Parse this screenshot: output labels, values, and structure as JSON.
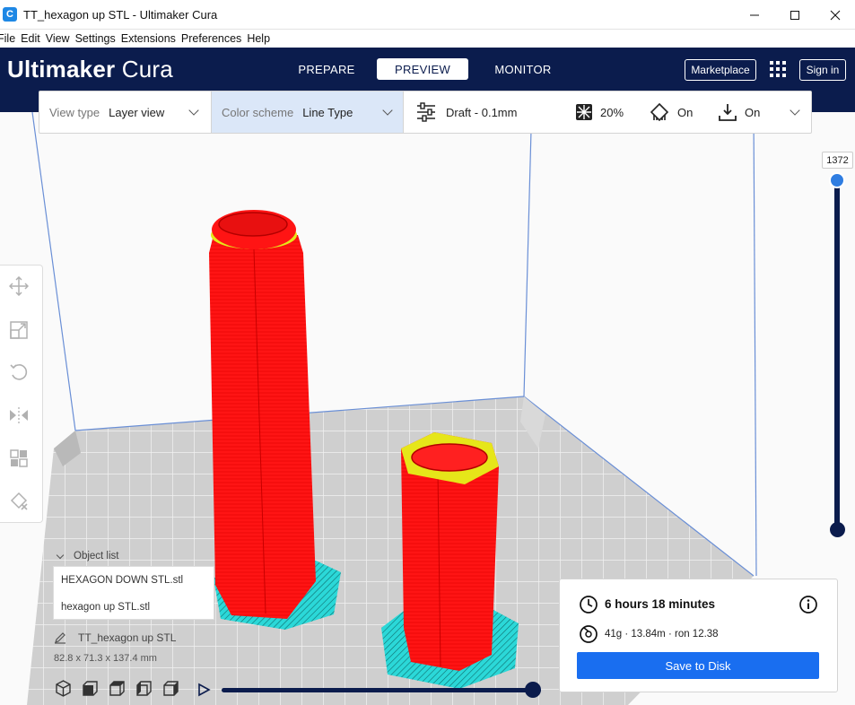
{
  "window": {
    "title": "TT_hexagon up STL - Ultimaker Cura",
    "app_icon_letter": "C"
  },
  "menubar": {
    "items": [
      "File",
      "Edit",
      "View",
      "Settings",
      "Extensions",
      "Preferences",
      "Help"
    ]
  },
  "header": {
    "logo_bold": "Ultimaker",
    "logo_light": "Cura",
    "tabs": [
      {
        "label": "PREPARE",
        "active": false
      },
      {
        "label": "PREVIEW",
        "active": true
      },
      {
        "label": "MONITOR",
        "active": false
      }
    ],
    "marketplace_label": "Marketplace",
    "signin_label": "Sign in"
  },
  "toolbar": {
    "view_type_label": "View type",
    "view_type_value": "Layer view",
    "color_scheme_label": "Color scheme",
    "color_scheme_value": "Line Type",
    "profile": "Draft - 0.1mm",
    "infill": "20%",
    "support": "On",
    "adhesion": "On"
  },
  "layer_slider": {
    "current_layer": "1372"
  },
  "object_list": {
    "header": "Object list",
    "items": [
      "HEXAGON DOWN STL.stl",
      "hexagon up STL.stl"
    ]
  },
  "job": {
    "name": "TT_hexagon up STL",
    "dimensions": "82.8 x 71.3 x 137.4 mm"
  },
  "playback": {
    "progress": 1.0
  },
  "print_info": {
    "time": "6 hours 18 minutes",
    "material": "41g · 13.84m · ron 12.38",
    "save_label": "Save to Disk"
  },
  "colors": {
    "header_bg": "#0b1c4d",
    "accent": "#196ef0",
    "wall": "#ff1a1a",
    "skin": "#e6e619",
    "support": "#2bd8d8",
    "build_plate": "#cdcdcd"
  }
}
